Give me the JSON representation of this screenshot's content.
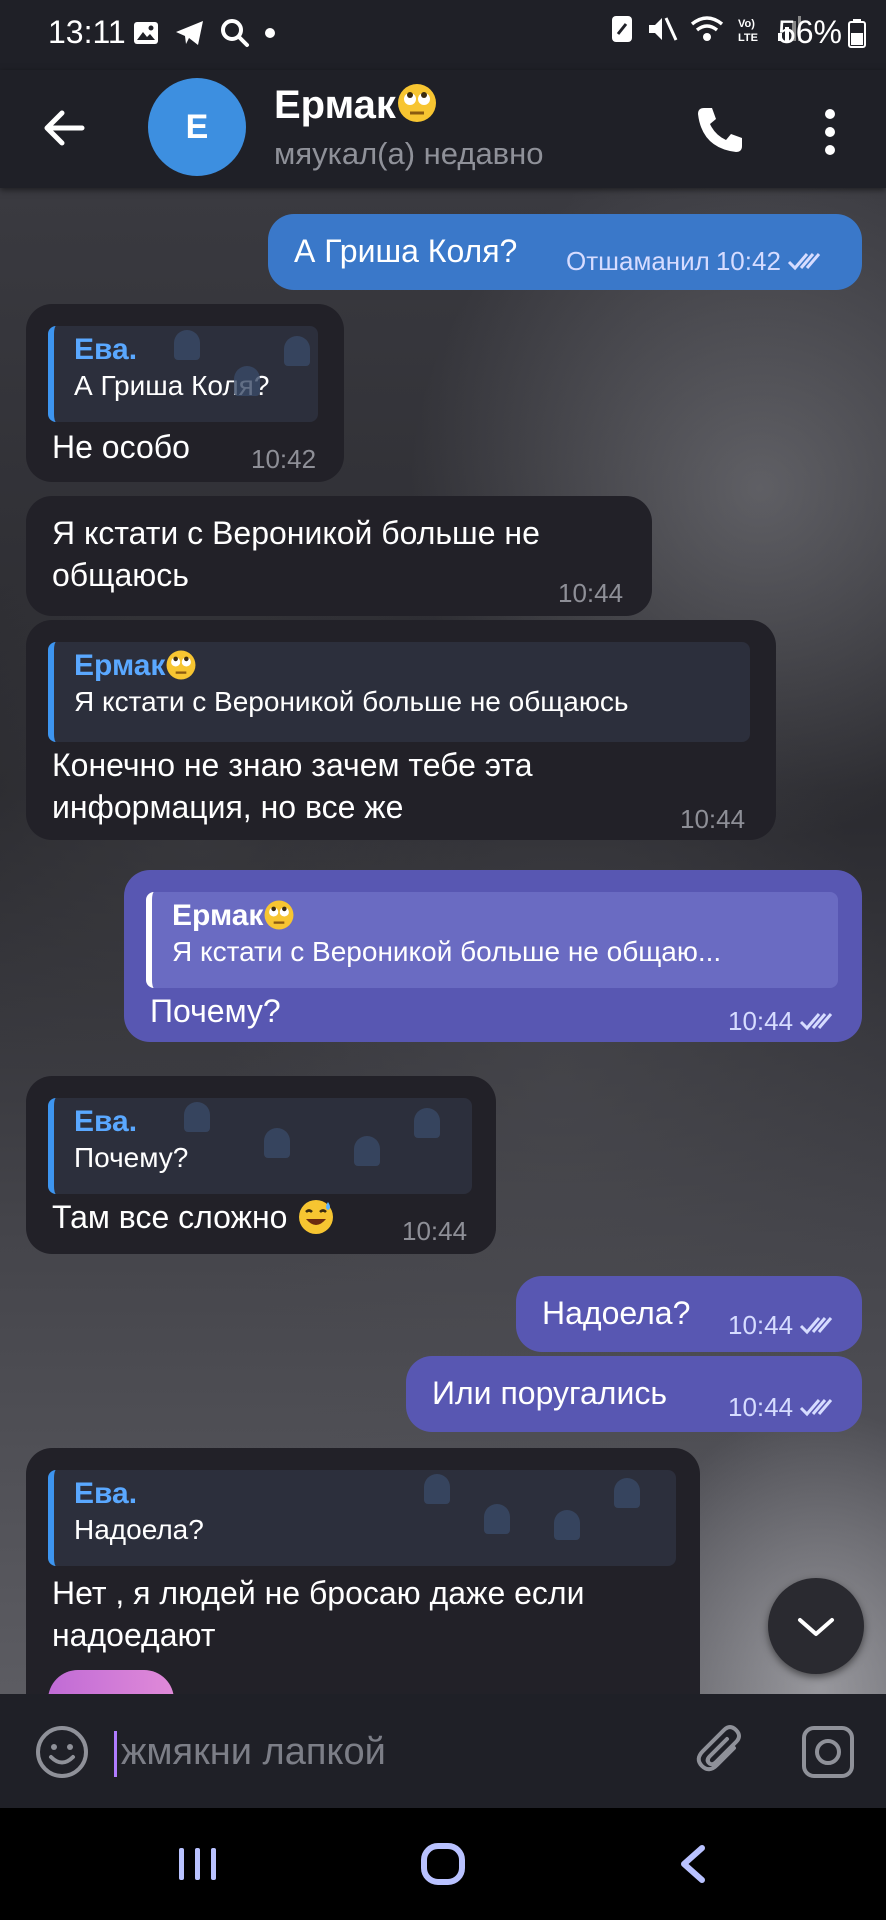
{
  "status_bar": {
    "time": "13:11",
    "battery": "56%"
  },
  "header": {
    "avatar_letter": "E",
    "title": "Ермак",
    "subtitle": "мяукал(а) недавно"
  },
  "messages": {
    "m1": {
      "text": "А Гриша Коля?",
      "status": "Отшаманил",
      "time": "10:42"
    },
    "m2": {
      "reply_name": "Ева.",
      "reply_text": "А Гриша Коля?",
      "text": "Не особо",
      "time": "10:42"
    },
    "m3": {
      "line1": "Я кстати с Вероникой больше не",
      "line2": "общаюсь",
      "time": "10:44"
    },
    "m4": {
      "reply_name": "Ермак",
      "reply_text": "Я кстати с Вероникой больше не общаюсь",
      "line1": "Конечно не знаю зачем тебе эта",
      "line2": "информация, но все же",
      "time": "10:44"
    },
    "m5": {
      "reply_name": "Ермак",
      "reply_text": "Я кстати с Вероникой больше не общаю...",
      "text": "Почему?",
      "time": "10:44"
    },
    "m6": {
      "reply_name": "Ева.",
      "reply_text": "Почему?",
      "text": "Там все сложно",
      "time": "10:44"
    },
    "m7": {
      "text": "Надоела?",
      "time": "10:44"
    },
    "m8": {
      "text": "Или поругались",
      "time": "10:44"
    },
    "m9": {
      "reply_name": "Ева.",
      "reply_text": "Надоела?",
      "line1": "Нет , я людей не бросаю даже если",
      "line2": "надоедают"
    }
  },
  "input": {
    "placeholder": "жмякни лапкой"
  },
  "icons": [
    "back-arrow-icon",
    "phone-icon",
    "more-vert-icon",
    "chevron-down-icon",
    "smile-icon",
    "paperclip-icon",
    "camera-icon",
    "double-check-icon",
    "roll-eyes-emoji-icon",
    "sweat-smile-emoji-icon"
  ]
}
